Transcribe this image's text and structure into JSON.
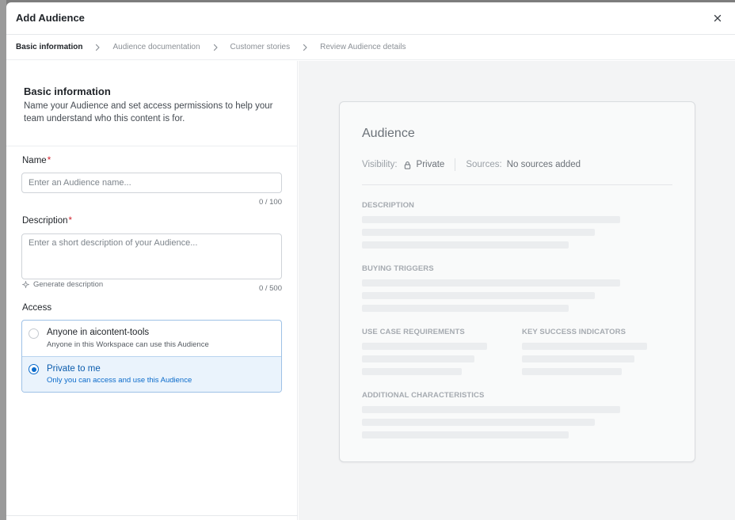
{
  "modal": {
    "title": "Add Audience",
    "close_icon": "close-icon"
  },
  "stepper": {
    "steps": [
      {
        "label": "Basic information",
        "active": true
      },
      {
        "label": "Audience documentation",
        "active": false
      },
      {
        "label": "Customer stories",
        "active": false
      },
      {
        "label": "Review Audience details",
        "active": false
      }
    ],
    "separator_icon": "chevron-right-icon"
  },
  "form": {
    "section_title": "Basic information",
    "section_description": "Name your Audience and set access permissions to help your team understand who this content is for.",
    "name": {
      "label": "Name",
      "required_mark": "*",
      "placeholder": "Enter an Audience name...",
      "value": "",
      "counter": "0 / 100"
    },
    "description": {
      "label": "Description",
      "required_mark": "*",
      "placeholder": "Enter a short description of your Audience...",
      "value": "",
      "counter": "0 / 500",
      "generate_label": "Generate description",
      "generate_icon": "sparkle-icon"
    },
    "access": {
      "label": "Access",
      "options": [
        {
          "title": "Anyone in aicontent-tools",
          "subtitle": "Anyone in this Workspace can use this Audience",
          "selected": false
        },
        {
          "title": "Private to me",
          "subtitle": "Only you can access and use this Audience",
          "selected": true
        }
      ]
    }
  },
  "preview": {
    "title": "Audience",
    "visibility_label": "Visibility:",
    "visibility_icon": "lock-icon",
    "visibility_value": "Private",
    "sources_label": "Sources:",
    "sources_value": "No sources added",
    "sections": {
      "description": "DESCRIPTION",
      "buying_triggers": "BUYING TRIGGERS",
      "use_case_requirements": "USE CASE REQUIREMENTS",
      "key_success_indicators": "KEY SUCCESS INDICATORS",
      "additional_characteristics": "ADDITIONAL CHARACTERISTICS"
    }
  },
  "colors": {
    "accent": "#0b6bcb",
    "selected_bg": "#eaf3fc",
    "required": "#d1242f",
    "skeleton": "#ebedef"
  }
}
